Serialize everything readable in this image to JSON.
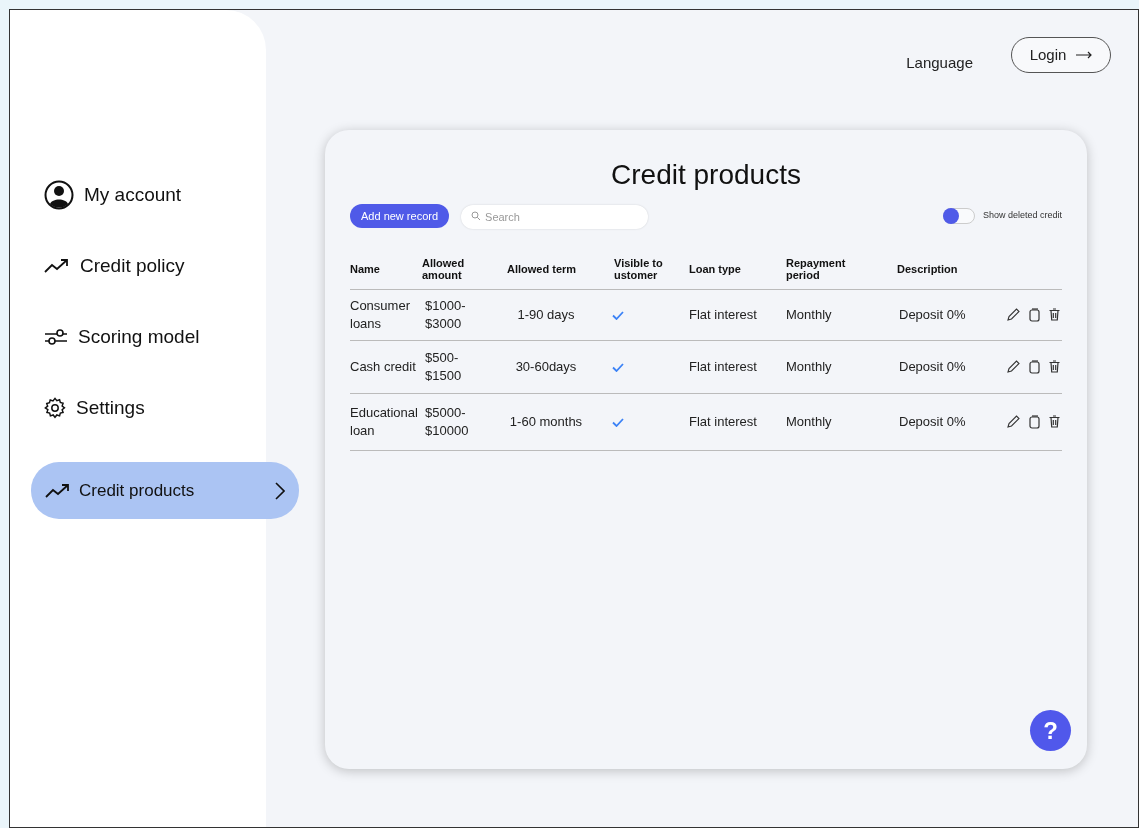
{
  "sidebar": {
    "items": [
      {
        "label": "My account",
        "selected": false
      },
      {
        "label": "Credit policy",
        "selected": false
      },
      {
        "label": "Scoring model",
        "selected": false
      },
      {
        "label": "Settings",
        "selected": false
      },
      {
        "label": "Credit products",
        "selected": true
      }
    ]
  },
  "header": {
    "language": "Language",
    "login": "Login"
  },
  "card": {
    "title": "Credit products",
    "add_button": "Add new record",
    "search": {
      "placeholder": "Search"
    },
    "toggle": {
      "label": "Show deleted credit",
      "on": false
    },
    "table": {
      "columns": [
        "Name",
        "Allowed amount",
        "Allowed term",
        "Visible to ustomer",
        "Loan type",
        "Repayment period",
        "Description"
      ],
      "rows": [
        {
          "name": "Consumer loans",
          "amount": "$1000- $3000",
          "term": "1-90 days",
          "visible": true,
          "loan_type": "Flat interest",
          "period": "Monthly",
          "description": "Deposit 0%"
        },
        {
          "name": "Cash credit",
          "amount": "$500- $1500",
          "term": "30-60days",
          "visible": true,
          "loan_type": "Flat interest",
          "period": "Monthly",
          "description": "Deposit 0%"
        },
        {
          "name": "Educational loan",
          "amount": "$5000- $10000",
          "term": "1-60 months",
          "visible": true,
          "loan_type": "Flat interest",
          "period": "Monthly",
          "description": "Deposit 0%"
        }
      ]
    },
    "help": "?"
  }
}
